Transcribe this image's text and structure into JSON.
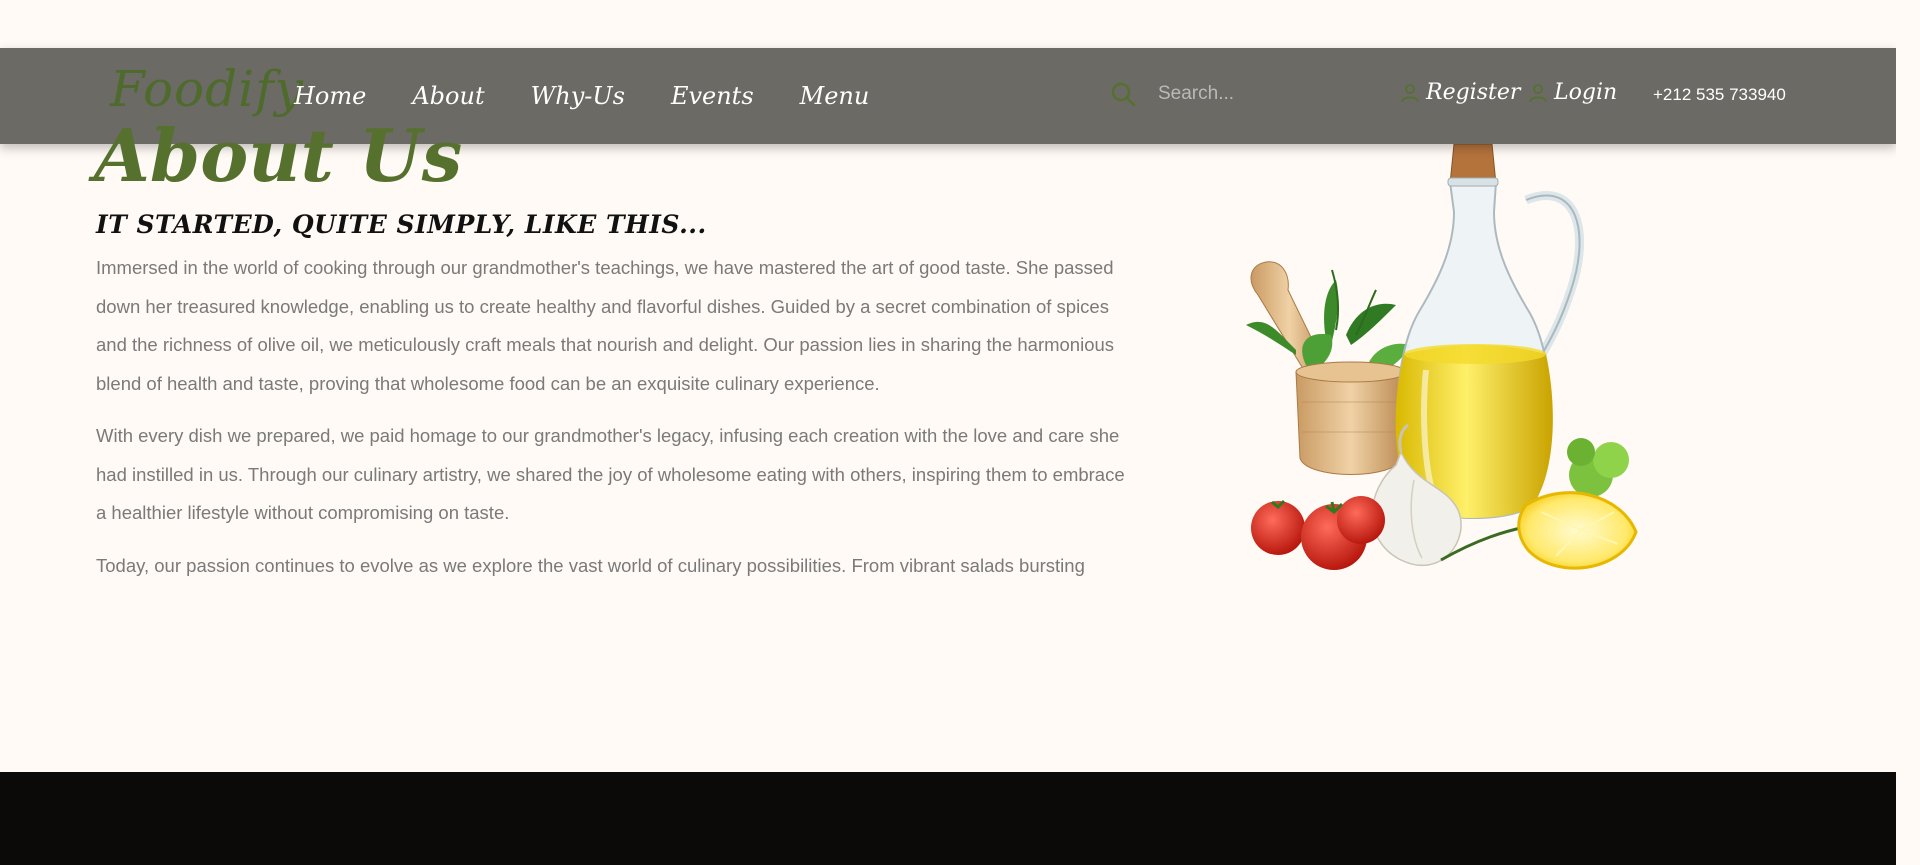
{
  "header": {
    "brand": "Foodify",
    "nav": [
      {
        "label": "Home"
      },
      {
        "label": "About"
      },
      {
        "label": "Why-Us"
      },
      {
        "label": "Events"
      },
      {
        "label": "Menu"
      }
    ],
    "search": {
      "placeholder": "Search...",
      "value": "",
      "icon": "search-icon"
    },
    "register_label": "Register",
    "login_label": "Login",
    "phone": "+212 535 733940"
  },
  "about": {
    "title": "About Us",
    "subtitle": "IT STARTED, QUITE SIMPLY, LIKE THIS...",
    "paragraphs": [
      "Immersed in the world of cooking through our grandmother's teachings, we have mastered the art of good taste. She passed down her treasured knowledge, enabling us to create healthy and flavorful dishes. Guided by a secret combination of spices and the richness of olive oil, we meticulously craft meals that nourish and delight. Our passion lies in sharing the harmonious blend of health and taste, proving that wholesome food can be an exquisite culinary experience.",
      "With every dish we prepared, we paid homage to our grandmother's legacy, infusing each creation with the love and care she had instilled in us. Through our culinary artistry, we shared the joy of wholesome eating with others, inspiring them to embrace a healthier lifestyle without compromising on taste.",
      "Today, our passion continues to evolve as we explore the vast world of culinary possibilities. From vibrant salads bursting"
    ]
  },
  "colors": {
    "accent": "#56702e",
    "navbar": "#6b6a65",
    "background": "#fffaf5",
    "footer": "#0b0a08",
    "body_text": "#7a7a7a"
  }
}
